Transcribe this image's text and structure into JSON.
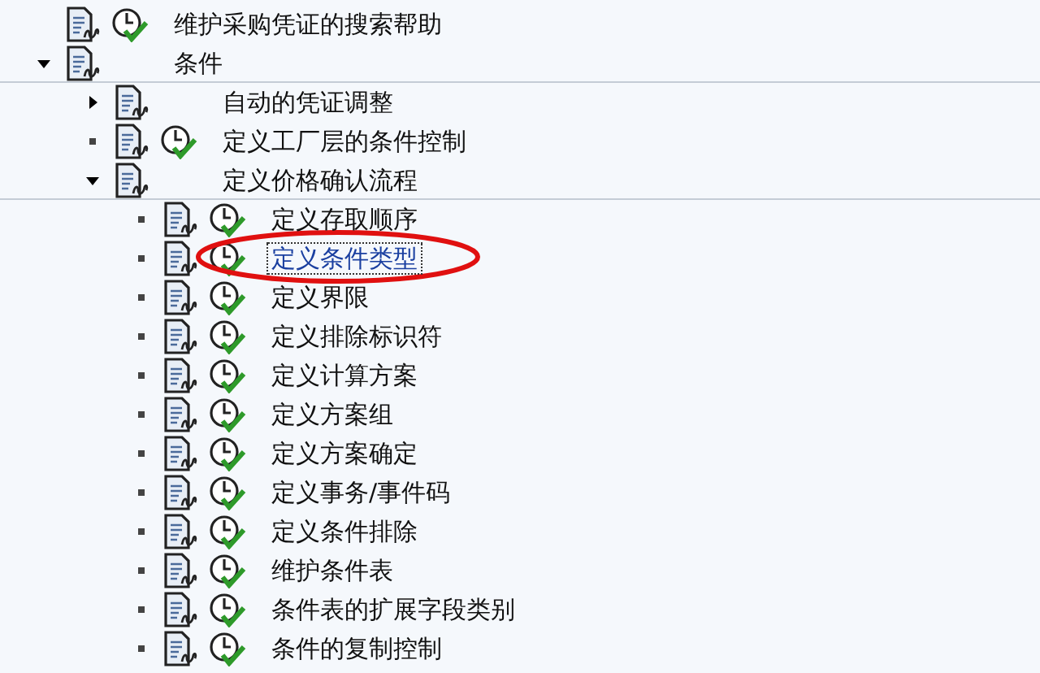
{
  "tree": [
    {
      "label": "维护采购凭证的搜索帮助",
      "kind": "leaf",
      "activity": true,
      "selected": false
    },
    {
      "label": "条件",
      "kind": "node",
      "expanded": true,
      "activity": false,
      "selected": false,
      "children": [
        {
          "label": "自动的凭证调整",
          "kind": "node",
          "expanded": false,
          "activity": false,
          "selected": false
        },
        {
          "label": "定义工厂层的条件控制",
          "kind": "leaf",
          "activity": true,
          "selected": false
        },
        {
          "label": "定义价格确认流程",
          "kind": "node",
          "expanded": true,
          "activity": false,
          "selected": false,
          "children": [
            {
              "label": "定义存取顺序",
              "kind": "leaf",
              "activity": true,
              "selected": false
            },
            {
              "label": "定义条件类型",
              "kind": "leaf",
              "activity": true,
              "selected": true
            },
            {
              "label": "定义界限",
              "kind": "leaf",
              "activity": true,
              "selected": false
            },
            {
              "label": "定义排除标识符",
              "kind": "leaf",
              "activity": true,
              "selected": false
            },
            {
              "label": "定义计算方案",
              "kind": "leaf",
              "activity": true,
              "selected": false
            },
            {
              "label": "定义方案组",
              "kind": "leaf",
              "activity": true,
              "selected": false
            },
            {
              "label": "定义方案确定",
              "kind": "leaf",
              "activity": true,
              "selected": false
            },
            {
              "label": "定义事务/事件码",
              "kind": "leaf",
              "activity": true,
              "selected": false
            },
            {
              "label": "定义条件排除",
              "kind": "leaf",
              "activity": true,
              "selected": false
            },
            {
              "label": "维护条件表",
              "kind": "leaf",
              "activity": true,
              "selected": false
            },
            {
              "label": "条件表的扩展字段类别",
              "kind": "leaf",
              "activity": true,
              "selected": false
            },
            {
              "label": "条件的复制控制",
              "kind": "leaf",
              "activity": true,
              "selected": false
            }
          ]
        }
      ]
    }
  ]
}
